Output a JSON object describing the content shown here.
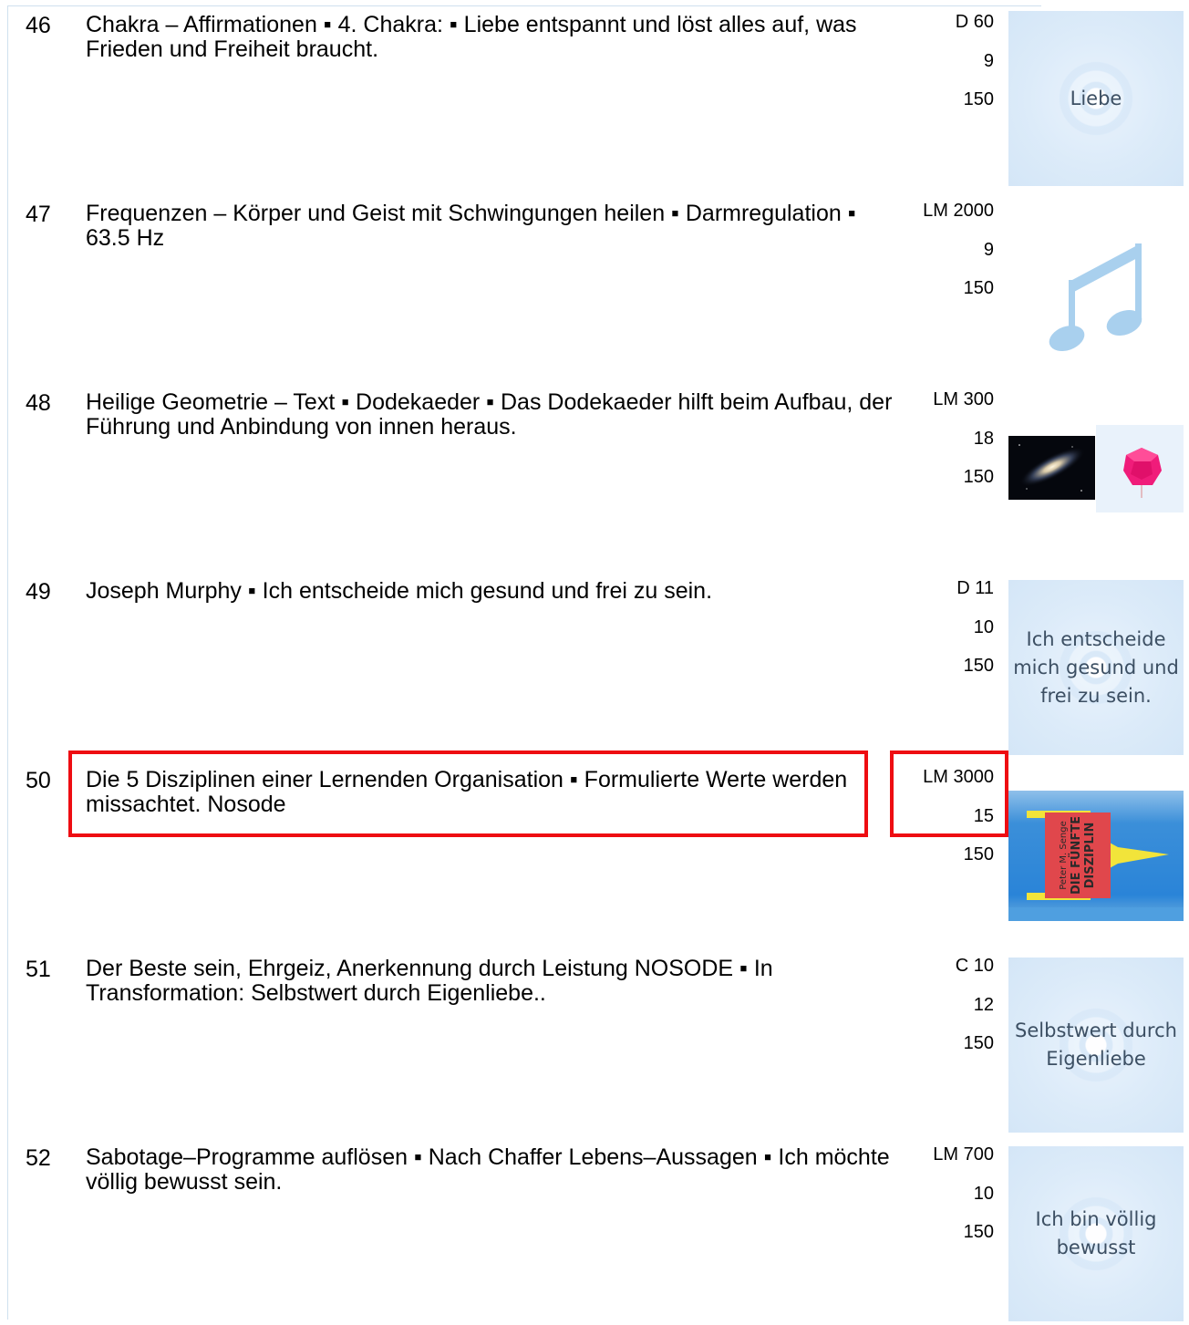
{
  "entries": [
    {
      "num": "46",
      "title": "Chakra – Affirmationen  ▪ 4. Chakra: ▪ Liebe entspannt und löst alles auf, was Frieden und Freiheit braucht.",
      "code": "D 60",
      "count": "9",
      "value": "150",
      "thumb_text": "Liebe"
    },
    {
      "num": "47",
      "title": "Frequenzen – Körper und Geist mit Schwingungen heilen ▪ Darmregulation ▪ 63.5 Hz",
      "code": "LM 2000",
      "count": "9",
      "value": "150",
      "thumb_icon": "music-note-icon"
    },
    {
      "num": "48",
      "title": "Heilige Geometrie – Text ▪ Dodekaeder ▪ Das Dodekaeder hilft beim Aufbau, der Führung und Anbindung von innen heraus.",
      "code": "LM 300",
      "count": "18",
      "value": "150",
      "thumb_icons": [
        "galaxy-image",
        "dodecahedron-image"
      ]
    },
    {
      "num": "49",
      "title": "Joseph Murphy ▪ Ich entscheide mich gesund und frei zu sein.",
      "code": "D 11",
      "count": "10",
      "value": "150",
      "thumb_text": "Ich entscheide mich gesund und frei zu sein."
    },
    {
      "num": "50",
      "title": "Die 5 Disziplinen einer Lernenden Organisation ▪ Formulierte Werte werden missachtet. Nosode",
      "code": "LM 3000",
      "count": "15",
      "value": "150",
      "highlighted": true,
      "book_author": "Peter M. Senge",
      "book_title_1": "DIE FÜNFTE",
      "book_title_2": "DISZIPLIN"
    },
    {
      "num": "51",
      "title": "Der Beste sein, Ehrgeiz, Anerkennung durch Leistung NOSODE ▪ In Transformation: Selbstwert durch Eigenliebe..",
      "code": "C 10",
      "count": "12",
      "value": "150",
      "thumb_text": "Selbstwert durch Eigenliebe"
    },
    {
      "num": "52",
      "title": "Sabotage–Programme auflösen  ▪ Nach Chaffer Lebens–Aussagen ▪ Ich möchte völlig bewusst sein.",
      "code": "LM 700",
      "count": "10",
      "value": "150",
      "thumb_text": "Ich bin völlig bewusst"
    }
  ],
  "colors": {
    "highlight": "#ee0d12",
    "affirmation_bg": "#dcebf9",
    "note": "#a9d0ee",
    "book_blue": "#2a84d8",
    "book_yellow": "#f2e43a",
    "book_red": "#e0474c"
  }
}
